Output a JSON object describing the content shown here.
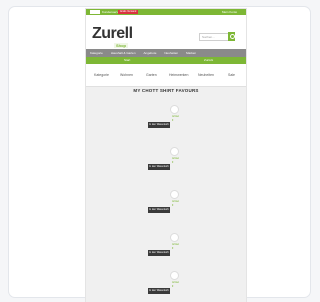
{
  "topbar": {
    "left_text": "Kundenservice",
    "promo_text": "Gratis Versand",
    "right_text": "Mein Konto"
  },
  "header": {
    "logo": "Zurell",
    "logo_sub": "Shop",
    "search_placeholder": "Suchen..."
  },
  "nav": {
    "items": [
      "Kategorie",
      "Haushalt & Garten",
      "Angebote",
      "Neuheiten",
      "Marken"
    ]
  },
  "subnav": {
    "items": [
      "Start",
      "Zurück"
    ]
  },
  "categories": [
    "Kategorie",
    "Wohnen",
    "Garten",
    "Heimwerken",
    "Neuheiten",
    "Sale"
  ],
  "page_title": "MY CHOTT SHIRT FAVOURS",
  "products": [
    {
      "name": "Artikel",
      "price": "€",
      "button": "In den Warenkorb"
    },
    {
      "name": "Artikel",
      "price": "€",
      "button": "In den Warenkorb"
    },
    {
      "name": "Artikel",
      "price": "€",
      "button": "In den Warenkorb"
    },
    {
      "name": "Artikel",
      "price": "€",
      "button": "In den Warenkorb"
    },
    {
      "name": "Artikel",
      "price": "€",
      "button": "In den Warenkorb"
    }
  ],
  "colors": {
    "accent": "#7db735",
    "nav_gray": "#8a8a8a",
    "button_dark": "#3a3a3a",
    "promo_red": "#d9333f"
  }
}
